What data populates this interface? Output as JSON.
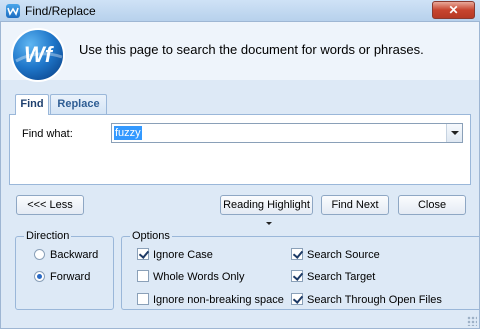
{
  "window": {
    "title": "Find/Replace",
    "logo_text": "Wf",
    "intro_text": "Use this page to search the document for words or phrases."
  },
  "tabs": [
    {
      "label": "Find",
      "selected": true
    },
    {
      "label": "Replace",
      "selected": false
    }
  ],
  "find": {
    "label": "Find what:",
    "value": "fuzzy"
  },
  "buttons": {
    "less": "<<< Less",
    "reading_highlight": "Reading Highlight",
    "find_next": "Find Next",
    "close": "Close"
  },
  "direction": {
    "legend": "Direction",
    "options": [
      {
        "label": "Backward",
        "selected": false
      },
      {
        "label": "Forward",
        "selected": true
      }
    ]
  },
  "options": {
    "legend": "Options",
    "checkboxes": [
      {
        "label": "Ignore Case",
        "checked": true
      },
      {
        "label": "Whole Words Only",
        "checked": false
      },
      {
        "label": "Ignore non-breaking space",
        "checked": false
      },
      {
        "label": "Search Source",
        "checked": true
      },
      {
        "label": "Search Target",
        "checked": true
      },
      {
        "label": "Search Through Open Files",
        "checked": true
      }
    ]
  },
  "colors": {
    "accent": "#3399ff",
    "window_bg": "#dde9f6",
    "close_button": "#c7452f"
  }
}
